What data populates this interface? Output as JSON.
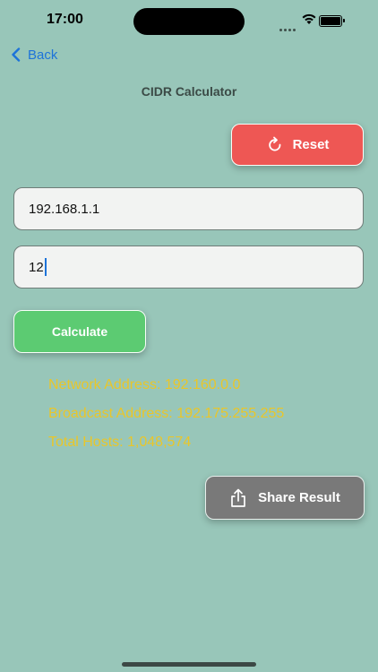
{
  "status_bar": {
    "time": "17:00"
  },
  "nav": {
    "back_label": "Back",
    "title": "CIDR Calculator"
  },
  "actions": {
    "reset_label": "Reset",
    "calculate_label": "Calculate",
    "share_label": "Share Result"
  },
  "inputs": {
    "ip_value": "192.168.1.1",
    "prefix_value": "12"
  },
  "results": {
    "network": "Network Address: 192.160.0.0",
    "broadcast": "Broadcast Address: 192.175.255.255",
    "hosts": "Total Hosts: 1,048,574"
  },
  "icons": {
    "back": "chevron-left-icon",
    "reset": "arrow-clockwise-icon",
    "share": "share-icon",
    "wifi": "wifi-icon",
    "battery": "battery-icon"
  },
  "colors": {
    "background": "#98c6b9",
    "accent_link": "#1d73d9",
    "reset_button": "#ee5754",
    "calculate_button": "#5ccb72",
    "share_button": "#797979",
    "result_text": "#e9c62a"
  }
}
